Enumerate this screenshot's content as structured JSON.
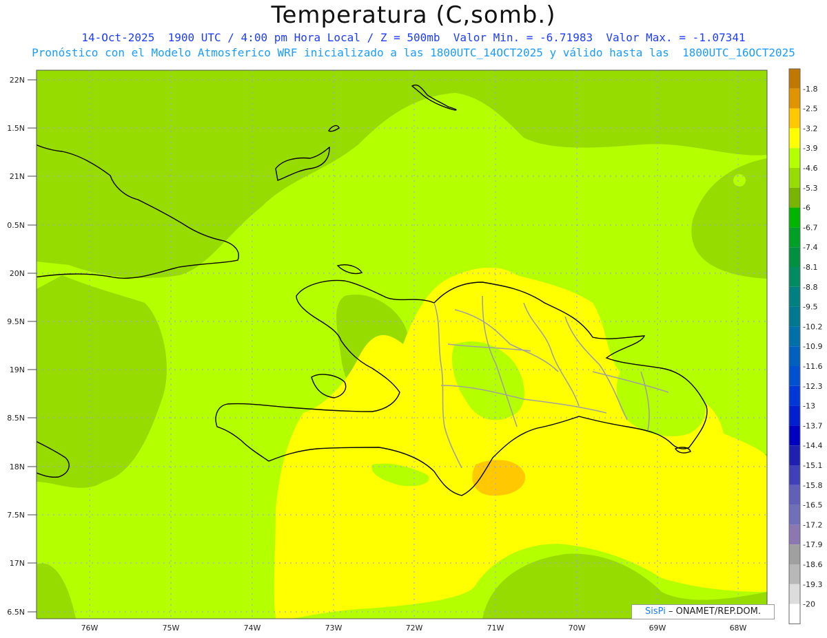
{
  "title": "Temperatura (C,somb.)",
  "subtitle1": "14-Oct-2025  1900 UTC / 4:00 pm Hora Local / Z = 500mb  Valor Min. = -6.71983  Valor Max. = -1.07341",
  "subtitle2": "Pronóstico con el Modelo Atmosferico WRF inicializado a las 1800UTC_14OCT2025 y válido hasta las  1800UTC_16OCT2025",
  "lat_labels": [
    "22N",
    "1.5N",
    "21N",
    "0.5N",
    "20N",
    "9.5N",
    "19N",
    "8.5N",
    "18N",
    "7.5N",
    "17N",
    "6.5N"
  ],
  "lon_labels": [
    "76W",
    "75W",
    "74W",
    "73W",
    "72W",
    "71W",
    "70W",
    "69W",
    "68W"
  ],
  "colorbar": [
    {
      "label": "-1.8",
      "color": "#c07800"
    },
    {
      "label": "-2.5",
      "color": "#e09400"
    },
    {
      "label": "-3.2",
      "color": "#ffc800"
    },
    {
      "label": "-3.9",
      "color": "#ffff00"
    },
    {
      "label": "-4.6",
      "color": "#b4ff00"
    },
    {
      "label": "-5.3",
      "color": "#96dc00"
    },
    {
      "label": "-6",
      "color": "#78b400"
    },
    {
      "label": "-6.7",
      "color": "#00b400"
    },
    {
      "label": "-7.4",
      "color": "#00a028"
    },
    {
      "label": "-8.1",
      "color": "#009040"
    },
    {
      "label": "-8.8",
      "color": "#008c60"
    },
    {
      "label": "-9.5",
      "color": "#008080"
    },
    {
      "label": "-10.2",
      "color": "#007890"
    },
    {
      "label": "-10.9",
      "color": "#0070a8"
    },
    {
      "label": "-11.6",
      "color": "#0060c0"
    },
    {
      "label": "-12.3",
      "color": "#0050d0"
    },
    {
      "label": "-13",
      "color": "#0038d8"
    },
    {
      "label": "-13.7",
      "color": "#0020d0"
    },
    {
      "label": "-14.4",
      "color": "#0000c0"
    },
    {
      "label": "-15.1",
      "color": "#2020b0"
    },
    {
      "label": "-15.8",
      "color": "#4040b8"
    },
    {
      "label": "-16.5",
      "color": "#6060b8"
    },
    {
      "label": "-17.2",
      "color": "#7070b8"
    },
    {
      "label": "-17.9",
      "color": "#8c78b0"
    },
    {
      "label": "-18.6",
      "color": "#a0a0a0"
    },
    {
      "label": "-19.3",
      "color": "#b8b8b8"
    },
    {
      "label": "-20",
      "color": "#dcdcdc"
    },
    {
      "label": "",
      "color": "#ffffff"
    }
  ],
  "credit": {
    "brand": "SisPi",
    "text": " – ONAMET/REP.DOM."
  }
}
